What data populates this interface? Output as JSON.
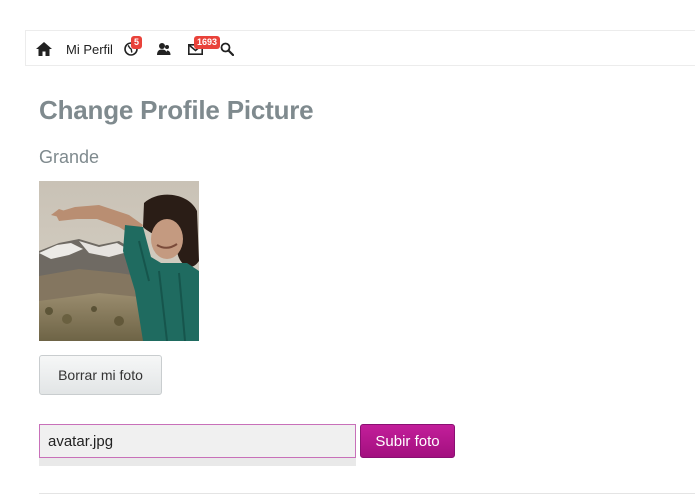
{
  "nav": {
    "profile_label": "Mi Perfil",
    "notifications_badge": "5",
    "messages_badge": "1693",
    "icons": [
      "home-icon",
      "globe-icon",
      "friends-icon",
      "envelope-icon",
      "search-icon"
    ],
    "badge_color": "#e9423a"
  },
  "main": {
    "title": "Change Profile Picture",
    "subtitle": "Grande",
    "delete_button_label": "Borrar mi foto",
    "file_input_value": "avatar.jpg",
    "upload_button_label": "Subir foto",
    "upload_button_color": "#b3168c",
    "heading_color": "#7f8a8e"
  }
}
